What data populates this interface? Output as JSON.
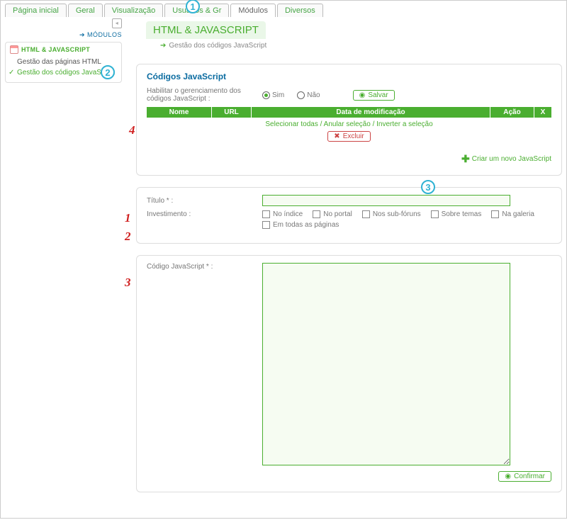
{
  "tabs": [
    "Página inicial",
    "Geral",
    "Visualização",
    "Usuários & Gr",
    "Módulos",
    "Diversos"
  ],
  "active_tab": 4,
  "sidebar": {
    "heading": "➔ MÓDULOS",
    "section_title": "HTML & JAVASCRIPT",
    "items": [
      {
        "label": "Gestão das páginas HTML",
        "active": false
      },
      {
        "label": "Gestão dos códigos JavaScript",
        "active": true
      }
    ]
  },
  "page": {
    "title": "HTML & JAVASCRIPT",
    "breadcrumb": "Gestão dos códigos JavaScript"
  },
  "panel1": {
    "title": "Códigos JavaScript",
    "enable_label": "Habilitar o gerenciamento dos códigos JavaScript :",
    "opt_yes": "Sim",
    "opt_no": "Não",
    "save_label": "Salvar",
    "headers": [
      "Nome",
      "URL",
      "Data de modificação",
      "Ação",
      "X"
    ],
    "select_links": "Selecionar todas / Anular seleção / Inverter a seleção",
    "delete_label": "Excluir",
    "create_label": "Criar um novo JavaScript"
  },
  "panel2": {
    "title_label": "Título * :",
    "title_value": "",
    "invest_label": "Investimento :",
    "checks": [
      "No índice",
      "No portal",
      "Nos sub-fóruns",
      "Sobre temas",
      "Na galeria",
      "Em todas as páginas"
    ]
  },
  "panel3": {
    "code_label": "Código JavaScript * :",
    "code_value": "",
    "confirm_label": "Confirmar"
  },
  "annotations": {
    "circ1": "1",
    "circ2": "2",
    "circ3": "3",
    "r1": "1",
    "r2": "2",
    "r3": "3",
    "r4": "4"
  }
}
